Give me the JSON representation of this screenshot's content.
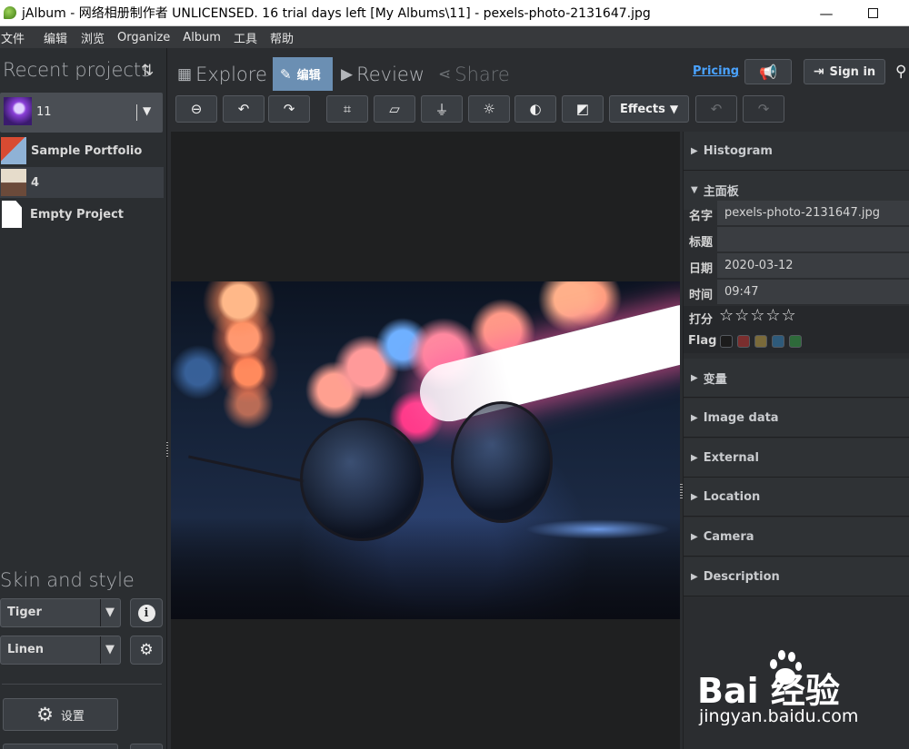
{
  "window": {
    "title": "jAlbum - 网络相册制作者 UNLICENSED. 16 trial days left [My Albums\\11] - pexels-photo-2131647.jpg",
    "minimize": "—"
  },
  "menu": [
    "文件",
    "编辑",
    "浏览",
    "Organize",
    "Album",
    "工具",
    "帮助"
  ],
  "sidebar": {
    "recent_title": "Recent projects",
    "sort_icon": "⇅",
    "current_project": "11",
    "projects": [
      {
        "label": "Sample Portfolio"
      },
      {
        "label": "4"
      },
      {
        "label": "Empty Project"
      }
    ],
    "skin_title": "Skin and style",
    "skin": "Tiger",
    "style": "Linen",
    "info_label": "i",
    "settings_label": "设置"
  },
  "tabs": {
    "explore": "Explore",
    "edit": "编辑",
    "review": "Review",
    "share": "Share"
  },
  "header": {
    "pricing": "Pricing",
    "signin": "Sign in"
  },
  "toolbar": {
    "effects": "Effects"
  },
  "panel": {
    "sections": {
      "histogram": "Histogram",
      "main": "主面板",
      "variables": "变量",
      "image_data": "Image data",
      "external": "External",
      "location": "Location",
      "camera": "Camera",
      "description": "Description"
    },
    "props": {
      "name_key": "名字",
      "name_val": "pexels-photo-2131647.jpg",
      "title_key": "标题",
      "title_val": "",
      "date_key": "日期",
      "date_val": "2020-03-12",
      "time_key": "时间",
      "time_val": "09:47",
      "rating_key": "打分",
      "rating_value": 0,
      "rating_max": 5,
      "stars": "☆☆☆☆☆",
      "flag_key": "Flag"
    },
    "flag_colors": [
      "#1c1c1c",
      "#7a2e2e",
      "#7a6a3a",
      "#2e5a7a",
      "#2e6a3a"
    ]
  },
  "watermark": {
    "brand": "Bai  经验",
    "domain": "jingyan.baidu.com"
  }
}
